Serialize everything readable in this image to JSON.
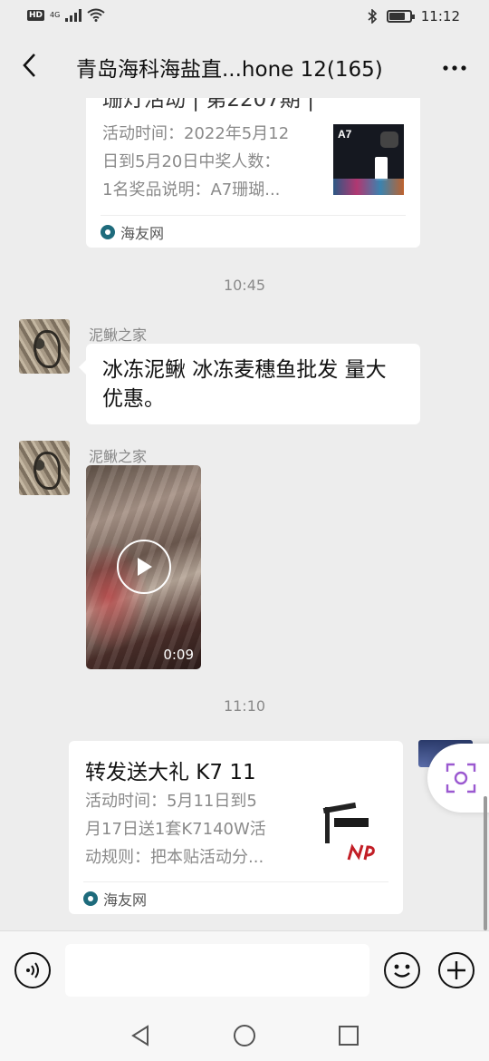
{
  "status_bar": {
    "hd": "HD",
    "network": "4G",
    "time": "11:12",
    "battery_level": 0.8,
    "icons": [
      "signal-icon",
      "wifi-icon",
      "bluetooth-icon",
      "battery-icon"
    ]
  },
  "header": {
    "title": "青岛海科海盐直...hone 12(165)",
    "back_icon": "chevron-left-icon",
    "more_icon": "more-dots-icon"
  },
  "messages": [
    {
      "type": "link_card",
      "title_partial": "珊灯活动 | 第2207期 |",
      "description": "活动时间：2022年5月12日到5月20日中奖人数：1名奖品说明：A7珊瑚...",
      "desc_lines": [
        "活动时间：2022年5月12",
        "日到5月20日中奖人数：",
        "1名奖品说明：A7珊瑚..."
      ],
      "thumbnail_label": "A7",
      "source": "海友网"
    },
    {
      "type": "timestamp",
      "text": "10:45"
    },
    {
      "type": "text",
      "sender": "泥鳅之家",
      "lines": [
        "冰冻泥鳅 冰冻麦穗鱼批发 量大",
        "优惠。"
      ]
    },
    {
      "type": "video",
      "sender": "泥鳅之家",
      "duration": "0:09"
    },
    {
      "type": "timestamp",
      "text": "11:10"
    },
    {
      "type": "link_card",
      "title": "转发送大礼 K7 11",
      "desc_lines": [
        "活动时间：5月11日到5",
        "月17日送1套K7140W活",
        "动规则：把本贴活动分..."
      ],
      "source": "海友网"
    }
  ],
  "input_bar": {
    "voice_icon": "voice-icon",
    "input_placeholder": "",
    "emoji_icon": "emoji-icon",
    "plus_icon": "plus-icon"
  },
  "floating": {
    "icon": "scan-text-icon",
    "accent": "#9b59d0"
  },
  "nav_bar": {
    "icons": [
      "nav-back-icon",
      "nav-home-icon",
      "nav-recents-icon"
    ]
  },
  "colors": {
    "background": "#ededed",
    "bubble": "#ffffff",
    "timestamp": "#8a8a8a"
  }
}
